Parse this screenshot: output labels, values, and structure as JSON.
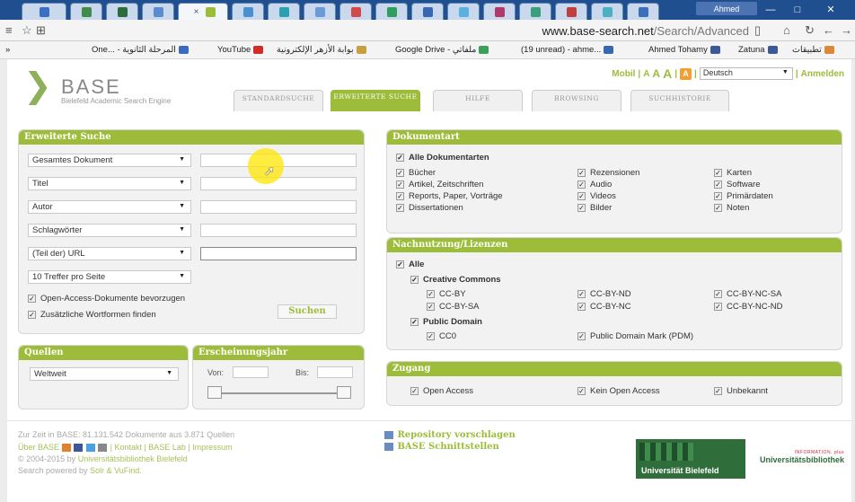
{
  "browser": {
    "user_badge": "Ahmed",
    "active_tab_close": "×",
    "window_min": "—",
    "window_max": "□",
    "window_close": "✕",
    "address": {
      "domain": "www.base-search.net",
      "path": "/Search/Advanced"
    },
    "bookmarks": [
      "One... - المرحلة الثانوية",
      "YouTube",
      "بوابة الأزهر الإلكترونية",
      "Google Drive - ملفاتي",
      "(19 unread) - ahme...",
      "Ahmed Tohamy",
      "Zatuna",
      "تطبيقات"
    ],
    "bookmarks_more": "»"
  },
  "header": {
    "logo_name": "BASE",
    "logo_sub": "Bielefeld Academic Search Engine",
    "tabs": [
      "STANDARDSUCHE",
      "ERWEITERTE SUCHE",
      "HILFE",
      "BROWSING",
      "SUCHHISTORIE"
    ],
    "mobil": "Mobil",
    "font_a_small": "A",
    "font_a_mid": "A",
    "font_a_big": "A",
    "contrast_label": "A",
    "language": "Deutsch",
    "login": "Anmelden",
    "sep": "|"
  },
  "advanced": {
    "title": "Erweiterte Suche",
    "fields": [
      "Gesamtes Dokument",
      "Titel",
      "Autor",
      "Schlagwörter",
      "(Teil der) URL"
    ],
    "hits_per_page": "10 Treffer pro Seite",
    "opt_open_access": "Open-Access-Dokumente bevorzugen",
    "opt_word_forms": "Zusätzliche Wortformen finden",
    "search_button": "Suchen"
  },
  "sources": {
    "title": "Quellen",
    "value": "Weltweit"
  },
  "year": {
    "title": "Erscheinungsjahr",
    "from": "Von:",
    "to": "Bis:"
  },
  "doctype": {
    "title": "Dokumentart",
    "all": "Alle Dokumentarten",
    "col1": [
      "Bücher",
      "Artikel, Zeitschriften",
      "Reports, Paper, Vorträge",
      "Dissertationen"
    ],
    "col2": [
      "Rezensionen",
      "Audio",
      "Videos",
      "Bilder"
    ],
    "col3": [
      "Karten",
      "Software",
      "Primärdaten",
      "Noten"
    ]
  },
  "licenses": {
    "title": "Nachnutzung/Lizenzen",
    "all": "Alle",
    "cc": "Creative Commons",
    "cc_col1": [
      "CC-BY",
      "CC-BY-SA"
    ],
    "cc_col2": [
      "CC-BY-ND",
      "CC-BY-NC"
    ],
    "cc_col3": [
      "CC-BY-NC-SA",
      "CC-BY-NC-ND"
    ],
    "pd": "Public Domain",
    "pd_items": [
      "CC0",
      "Public Domain Mark (PDM)"
    ]
  },
  "access": {
    "title": "Zugang",
    "items": [
      "Open Access",
      "Kein Open Access",
      "Unbekannt"
    ]
  },
  "footer": {
    "line1": "Zur Zeit in BASE: 81.131.542 Dokumente aus 3.871 Quellen",
    "line2_prefix": "Über BASE",
    "line2_links": "| Kontakt | BASE Lab | Impressum",
    "line3_prefix": "© 2004-2015 by",
    "line3_link": "Universitätsbibliothek Bielefeld",
    "line4_prefix": "Search powered by",
    "line4_link": "Solr & VuFind.",
    "repo": "Repository vorschlagen",
    "interfaces": "BASE Schnittstellen",
    "uni": "Universität Bielefeld",
    "ub_small": "INFORMATION. plus",
    "ub_big": "Universitätsbibliothek"
  },
  "colors": {
    "accent": "#9dbd3a",
    "tabstrip": "#1f4f8f"
  }
}
